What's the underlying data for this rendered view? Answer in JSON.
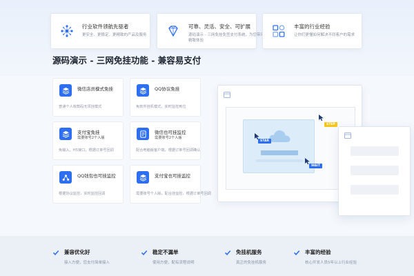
{
  "features": [
    {
      "icon": "network-icon",
      "title": "行业软件领航先驱者",
      "desc": "更安全、更稳定、更精致的产品及服务"
    },
    {
      "icon": "diamond-icon",
      "title": "可靠、灵活、安全、可扩展",
      "desc_lines": [
        "源码演示 - 三网免挂免签支付系统，为您带来最优质的",
        "精致体验"
      ]
    },
    {
      "icon": "blocks-icon",
      "title": "丰富的行业经验",
      "desc": "让你们更懂如何解决不同客户的需求"
    }
  ],
  "section_title": "源码演示 - 三网免挂功能 - 兼容易支付",
  "services": [
    {
      "title": "微信店员模式免挂",
      "sub": "",
      "desc": "普通个人收款码无须挂模式"
    },
    {
      "title": "QQ协议免挂",
      "sub": "",
      "desc": "免软件挂机模式，实时监控到位"
    },
    {
      "title": "支付宝免挂",
      "sub": "需要账号2个人版",
      "desc": "免输入、H5接口，根据订单号回调"
    },
    {
      "title": "微信也可挂监控",
      "sub": "需要账号2个人版",
      "desc": "配合电脑版客户端，根据订单号回调确认"
    },
    {
      "title": "QQ钱包也可挂监控",
      "sub": "",
      "desc": "根据协议监控，实时监控回调"
    },
    {
      "title": "支付宝也可挂监控",
      "sub": "",
      "desc": "需要账号个人版，配合挂监控，根据订单号回调"
    }
  ],
  "illustration": {
    "tags": [
      {
        "label": "STAR"
      },
      {
        "label": "STEP"
      },
      {
        "label": "WAIT"
      }
    ]
  },
  "perks": [
    {
      "title": "兼容优化好",
      "desc": "接入方便，您支付简单接入"
    },
    {
      "title": "稳定不漏单",
      "desc": "使用方便，配有流程说明"
    },
    {
      "title": "免挂机服务",
      "desc": "真正的免挂机服务"
    },
    {
      "title": "丰富的经验",
      "desc": "核心开发人员5年以上行业经验"
    }
  ],
  "colors": {
    "accent": "#2e6ff2",
    "tag_blue": "#2e6ff2",
    "tag_yellow": "#f5c518"
  }
}
